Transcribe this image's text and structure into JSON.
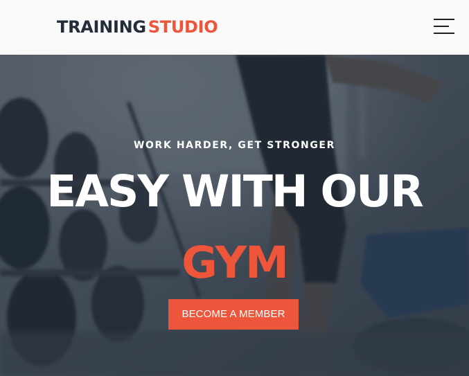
{
  "header": {
    "logo_part1": "TRAINING",
    "logo_part2": "STUDIO",
    "menu_icon": "hamburger-menu-icon"
  },
  "hero": {
    "tagline": "WORK HARDER, GET STRONGER",
    "headline_line1": "EASY WITH OUR",
    "headline_line2": "GYM",
    "cta_label": "BECOME A MEMBER"
  },
  "colors": {
    "brand_dark": "#232d39",
    "accent": "#ed563b",
    "header_bg": "#f9f9f9"
  }
}
